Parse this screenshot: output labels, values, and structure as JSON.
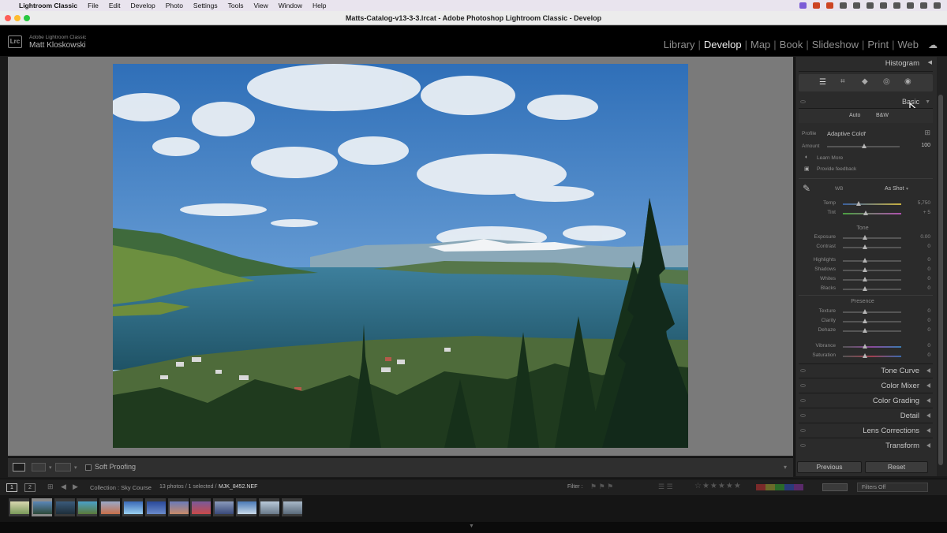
{
  "menubar": {
    "app": "Lightroom Classic",
    "items": [
      "File",
      "Edit",
      "Develop",
      "Photo",
      "Settings",
      "Tools",
      "View",
      "Window",
      "Help"
    ]
  },
  "window": {
    "title": "Matts-Catalog-v13-3-3.lrcat - Adobe Photoshop Lightroom Classic - Develop"
  },
  "identity": {
    "product": "Adobe Lightroom Classic",
    "user": "Matt Kloskowski",
    "logo": "Lrc"
  },
  "modules": [
    "Library",
    "Develop",
    "Map",
    "Book",
    "Slideshow",
    "Print",
    "Web"
  ],
  "active_module": "Develop",
  "right_panel": {
    "histogram_label": "Histogram",
    "basic_label": "Basic",
    "treatment": {
      "auto": "Auto",
      "bw": "B&W"
    },
    "profile_label": "Profile",
    "profile_value": "Adaptive Color",
    "amount_label": "Amount",
    "amount_value": "100",
    "learn_more": "Learn More",
    "feedback": "Provide feedback",
    "wb_label": "WB",
    "wb_value": "As Shot",
    "temp": {
      "label": "Temp",
      "value": "5,750"
    },
    "tint": {
      "label": "Tint",
      "value": "+ 5"
    },
    "tone_label": "Tone",
    "tone_sliders": [
      {
        "label": "Exposure",
        "value": "0.00"
      },
      {
        "label": "Contrast",
        "value": "0"
      },
      {
        "label": "Highlights",
        "value": "0"
      },
      {
        "label": "Shadows",
        "value": "0"
      },
      {
        "label": "Whites",
        "value": "0"
      },
      {
        "label": "Blacks",
        "value": "0"
      }
    ],
    "presence_label": "Presence",
    "presence_sliders": [
      {
        "label": "Texture",
        "value": "0"
      },
      {
        "label": "Clarity",
        "value": "0"
      },
      {
        "label": "Dehaze",
        "value": "0"
      },
      {
        "label": "Vibrance",
        "value": "0"
      },
      {
        "label": "Saturation",
        "value": "0"
      }
    ],
    "sections": [
      "Tone Curve",
      "Color Mixer",
      "Color Grading",
      "Detail",
      "Lens Corrections",
      "Transform"
    ],
    "previous_btn": "Previous",
    "reset_btn": "Reset"
  },
  "toolbar": {
    "soft_proofing": "Soft Proofing"
  },
  "filmbar": {
    "page1": "1",
    "page2": "2",
    "collection": "Collection : Sky Course",
    "count": "13 photos / 1 selected /",
    "filename": "MJK_8452.NEF",
    "filter_label": "Filter :",
    "filters_value": "Filters Off"
  },
  "filmstrip_thumbs": 13
}
